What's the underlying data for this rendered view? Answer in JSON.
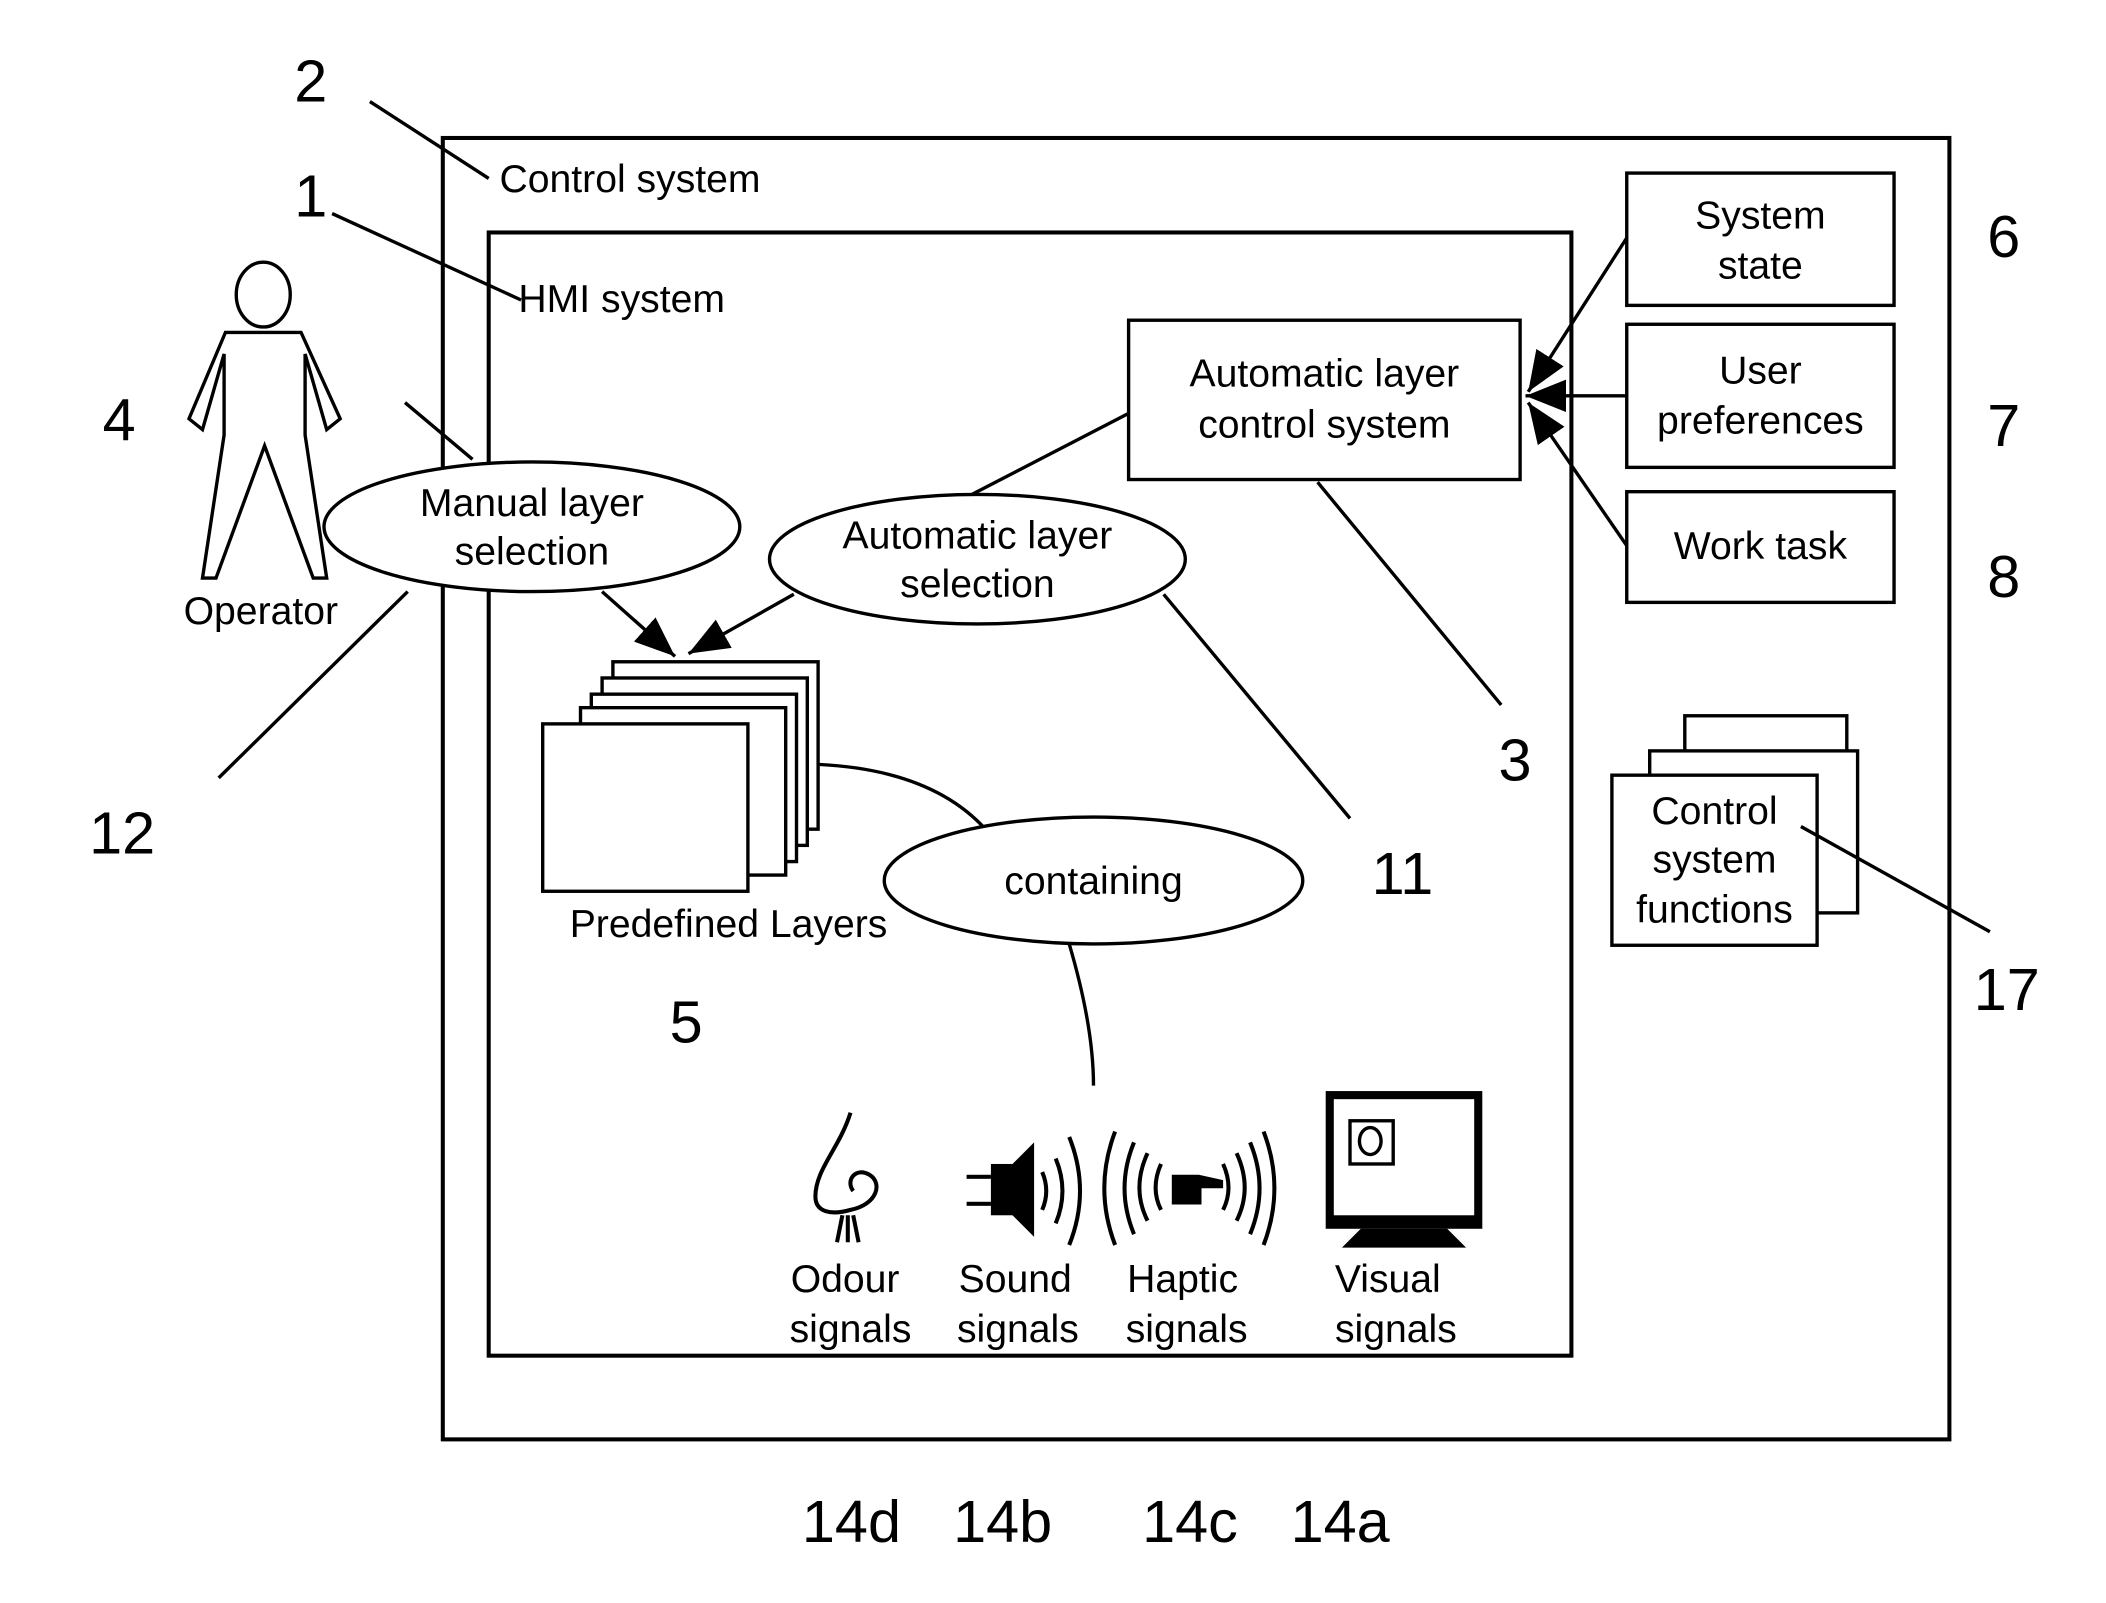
{
  "diagram": {
    "control_system": {
      "label": "Control system",
      "ref": "2"
    },
    "hmi_system": {
      "label": "HMI system",
      "ref": "1"
    },
    "operator": {
      "label": "Operator",
      "ref": "4"
    },
    "manual_selection": {
      "line1": "Manual layer",
      "line2": "selection",
      "ref": "12"
    },
    "automatic_selection": {
      "line1": "Automatic layer",
      "line2": "selection",
      "ref": "11"
    },
    "auto_control": {
      "line1": "Automatic layer",
      "line2": "control system",
      "ref": "3"
    },
    "inputs": [
      {
        "line1": "System",
        "line2": "state",
        "ref": "6"
      },
      {
        "line1": "User",
        "line2": "preferences",
        "ref": "7"
      },
      {
        "line1": "Work task",
        "line2": "",
        "ref": "8"
      }
    ],
    "layers": {
      "label": "Predefined Layers",
      "ref": "5"
    },
    "containing": {
      "label": "containing"
    },
    "functions": {
      "line1": "Control",
      "line2": "system",
      "line3": "functions",
      "ref": "17"
    },
    "signals": [
      {
        "line1": "Odour",
        "line2": "signals",
        "ref": "14d",
        "icon": "nose-icon"
      },
      {
        "line1": "Sound",
        "line2": "signals",
        "ref": "14b",
        "icon": "speaker-icon"
      },
      {
        "line1": "Haptic",
        "line2": "signals",
        "ref": "14c",
        "icon": "haptic-hand-icon"
      },
      {
        "line1": "Visual",
        "line2": "signals",
        "ref": "14a",
        "icon": "monitor-icon"
      }
    ]
  }
}
